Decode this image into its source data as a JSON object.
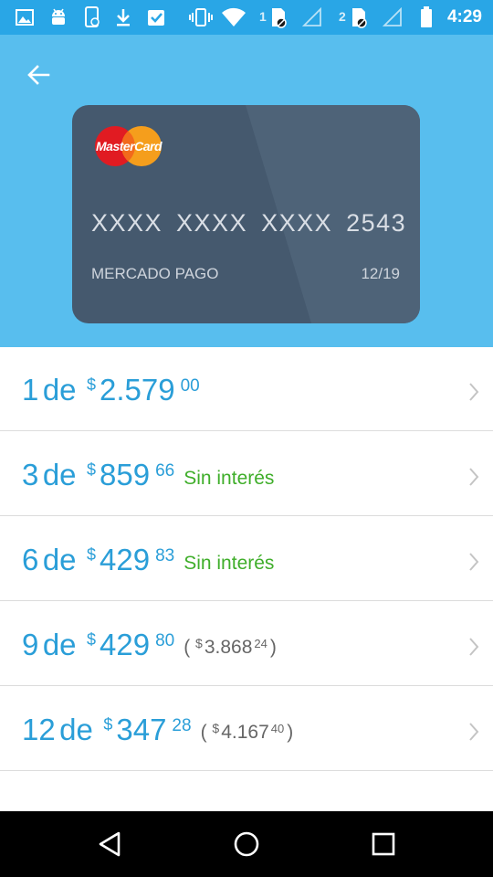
{
  "status_bar": {
    "time": "4:29",
    "sim1_label": "1",
    "sim2_label": "2",
    "icons": [
      "gallery-icon",
      "android-icon",
      "phone-sync-icon",
      "download-icon",
      "checklist-icon",
      "vibrate-icon",
      "wifi-icon",
      "sim1-icon",
      "signal-icon",
      "sim2-icon",
      "signal-icon",
      "battery-icon"
    ]
  },
  "header": {
    "back_icon": "arrow-left-icon",
    "card": {
      "brand": "MasterCard",
      "number": "XXXX XXXX XXXX 2543",
      "holder": "MERCADO PAGO",
      "expiry": "12/19"
    }
  },
  "installments": [
    {
      "count": "1",
      "separator": "de",
      "currency": "$",
      "amount": "2.579",
      "cents": "00",
      "note": "",
      "total_currency": "",
      "total_amount": "",
      "total_cents": ""
    },
    {
      "count": "3",
      "separator": "de",
      "currency": "$",
      "amount": "859",
      "cents": "66",
      "note": "Sin interés",
      "total_currency": "",
      "total_amount": "",
      "total_cents": ""
    },
    {
      "count": "6",
      "separator": "de",
      "currency": "$",
      "amount": "429",
      "cents": "83",
      "note": "Sin interés",
      "total_currency": "",
      "total_amount": "",
      "total_cents": ""
    },
    {
      "count": "9",
      "separator": "de",
      "currency": "$",
      "amount": "429",
      "cents": "80",
      "note": "",
      "total_open": "(",
      "total_currency": "$",
      "total_amount": "3.868",
      "total_cents": "24",
      "total_close": ")"
    },
    {
      "count": "12",
      "separator": "de",
      "currency": "$",
      "amount": "347",
      "cents": "28",
      "note": "",
      "total_open": "(",
      "total_currency": "$",
      "total_amount": "4.167",
      "total_cents": "40",
      "total_close": ")"
    }
  ],
  "nav_bar": {
    "back_icon": "triangle-back-icon",
    "home_icon": "circle-home-icon",
    "recents_icon": "square-recents-icon"
  },
  "colors": {
    "status_bar": "#29a6e6",
    "header": "#58beee",
    "card": "#45596e",
    "amount": "#2a9ed8",
    "no_interest": "#3fae2a",
    "total": "#666666"
  }
}
